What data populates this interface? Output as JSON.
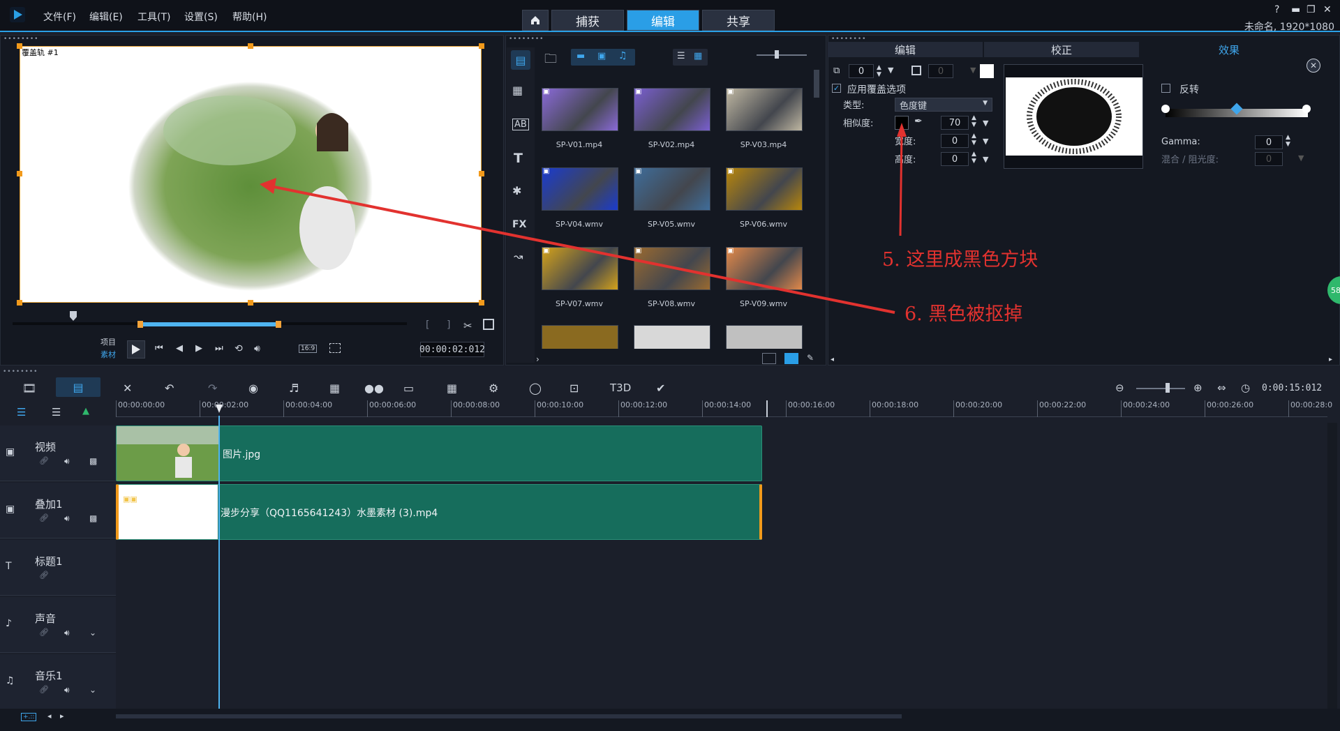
{
  "menu": [
    "文件(F)",
    "编辑(E)",
    "工具(T)",
    "设置(S)",
    "帮助(H)"
  ],
  "mode_tabs": {
    "capture": "捕获",
    "edit": "编辑",
    "share": "共享"
  },
  "project_info": "未命名, 1920*1080",
  "preview": {
    "overlay_label": "覆盖轨 #1",
    "project_label": "项目",
    "clip_label": "素材",
    "timecode": "00:00:02:012",
    "aspect": "16:9"
  },
  "library": {
    "items": [
      {
        "name": "SP-V01.mp4",
        "color": "#8a6ad8"
      },
      {
        "name": "SP-V02.mp4",
        "color": "#7a5fd0"
      },
      {
        "name": "SP-V03.mp4",
        "color": "#bfb7a2"
      },
      {
        "name": "SP-V04.wmv",
        "color": "#1a3bcf"
      },
      {
        "name": "SP-V05.wmv",
        "color": "#3f6d9a"
      },
      {
        "name": "SP-V06.wmv",
        "color": "#b8860b"
      },
      {
        "name": "SP-V07.wmv",
        "color": "#d3a21b"
      },
      {
        "name": "SP-V08.wmv",
        "color": "#9a6a30"
      },
      {
        "name": "SP-V09.wmv",
        "color": "#e2894a"
      }
    ]
  },
  "options": {
    "tabs": {
      "edit": "编辑",
      "correct": "校正",
      "effects": "效果"
    },
    "top_spin1": "0",
    "top_spin2": "0",
    "apply_overlay": "应用覆盖选项",
    "type_label": "类型:",
    "type_value": "色度键",
    "similarity_label": "相似度:",
    "similarity_value": "70",
    "width_label": "宽度:",
    "width_value": "0",
    "height_label": "高度:",
    "height_value": "0",
    "invert_label": "反转",
    "gamma_label": "Gamma:",
    "gamma_value": "0",
    "blend_label": "混合 / 阻光度:",
    "blend_value": "0",
    "badge": "58"
  },
  "annotations": {
    "a5": "5. 这里成黑色方块",
    "a6": "6. 黑色被抠掉"
  },
  "timeline": {
    "duration": "0:00:15:012",
    "ruler": [
      "00:00:00:00",
      "00:00:02:00",
      "00:00:04:00",
      "00:00:06:00",
      "00:00:08:00",
      "00:00:10:00",
      "00:00:12:00",
      "00:00:14:00",
      "00:00:16:00",
      "00:00:18:00",
      "00:00:20:00",
      "00:00:22:00",
      "00:00:24:00",
      "00:00:26:00",
      "00:00:28:0"
    ],
    "tracks": [
      {
        "name": "视频"
      },
      {
        "name": "叠加1"
      },
      {
        "name": "标题1"
      },
      {
        "name": "声音"
      },
      {
        "name": "音乐1"
      }
    ],
    "clip_video": "图片.jpg",
    "clip_overlay": "漫步分享（QQ1165641243）水墨素材 (3).mp4",
    "zoom_label": "+.::"
  }
}
